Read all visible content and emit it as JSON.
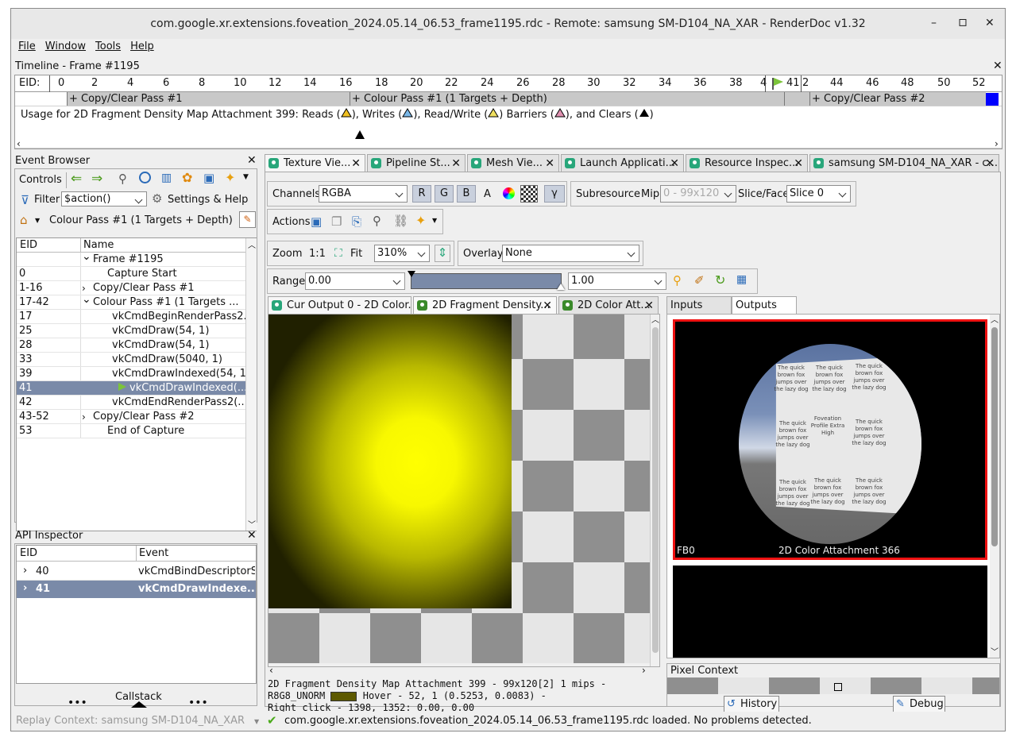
{
  "window": {
    "title": "com.google.xr.extensions.foveation_2024.05.14_06.53_frame1195.rdc - Remote: samsung SM-D104_NA_XAR - RenderDoc v1.32",
    "minimize": "–",
    "maximize": "▫",
    "close": "✕"
  },
  "menu": [
    "File",
    "Window",
    "Tools",
    "Help"
  ],
  "timeline": {
    "title": "Timeline - Frame #1195",
    "eid_label": "EID:",
    "ticks": [
      "0",
      "2",
      "4",
      "6",
      "8",
      "10",
      "12",
      "14",
      "16",
      "18",
      "20",
      "22",
      "24",
      "26",
      "28",
      "30",
      "32",
      "34",
      "36",
      "38",
      "4",
      "41",
      "2",
      "44",
      "46",
      "48",
      "50",
      "52"
    ],
    "passes": [
      "+ Copy/Clear Pass #1",
      "+ Colour Pass #1 (1 Targets + Depth)",
      "+ Copy/Clear Pass #2"
    ],
    "usage_prefix": "Usage for 2D Fragment Density Map Attachment 399:  Reads (",
    "usage_writes": "), Writes (",
    "usage_rw": "), Read/Write (",
    "usage_barriers": ") Barriers (",
    "usage_clears": "), and Clears (",
    "usage_suffix": ")"
  },
  "event_browser": {
    "title": "Event Browser",
    "controls_label": "Controls",
    "filter_label": "Filter",
    "filter_value": "$action()",
    "settings_label": "Settings & Help",
    "breadcrumb": "Colour Pass #1 (1 Targets + Depth)",
    "col_eid": "EID",
    "col_name": "Name",
    "rows": [
      {
        "eid": "",
        "name": "Frame #1195"
      },
      {
        "eid": "0",
        "name": "Capture Start"
      },
      {
        "eid": "1-16",
        "name": "Copy/Clear Pass #1"
      },
      {
        "eid": "17-42",
        "name": "Colour Pass #1 (1 Targets ..."
      },
      {
        "eid": "17",
        "name": "vkCmdBeginRenderPass2..."
      },
      {
        "eid": "25",
        "name": "vkCmdDraw(54, 1)"
      },
      {
        "eid": "28",
        "name": "vkCmdDraw(54, 1)"
      },
      {
        "eid": "33",
        "name": "vkCmdDraw(5040, 1)"
      },
      {
        "eid": "39",
        "name": "vkCmdDrawIndexed(54, 1)"
      },
      {
        "eid": "41",
        "name": "vkCmdDrawIndexed(..."
      },
      {
        "eid": "42",
        "name": "vkCmdEndRenderPass2(..."
      },
      {
        "eid": "43-52",
        "name": "Copy/Clear Pass #2"
      },
      {
        "eid": "53",
        "name": "End of Capture"
      }
    ]
  },
  "api_inspector": {
    "title": "API Inspector",
    "col_eid": "EID",
    "col_event": "Event",
    "rows": [
      {
        "eid": "40",
        "event": "vkCmdBindDescriptorSe"
      },
      {
        "eid": "41",
        "event": "vkCmdDrawIndexe..."
      }
    ],
    "callstack": "Callstack",
    "dots": "•••"
  },
  "main_tabs": [
    "Texture Vie...",
    "Pipeline St...",
    "Mesh Vie...",
    "Launch Applicati...",
    "Resource Inspec...",
    "samsung SM-D104_NA_XAR - c..."
  ],
  "texture_viewer": {
    "channels_label": "Channels",
    "channels_value": "RGBA",
    "r": "R",
    "g": "G",
    "b": "B",
    "a": "A",
    "gamma": "γ",
    "subresource_label": "Subresource",
    "mip_label": "Mip",
    "mip_value": "0 - 99x120",
    "slice_label": "Slice/Face",
    "slice_value": "Slice 0",
    "actions_label": "Actions",
    "zoom_label": "Zoom",
    "zoom_1to1": "1:1",
    "fit_label": "Fit",
    "zoom_value": "310%",
    "overlay_label": "Overlay",
    "overlay_value": "None",
    "range_label": "Range",
    "range_min": "0.00",
    "range_max": "1.00",
    "sub_tabs": [
      "Cur Output 0 - 2D Color...",
      "2D Fragment Density...",
      "2D Color Att..."
    ],
    "status_line1": "2D Fragment Density Map Attachment 399 - 99x120[2] 1 mips -",
    "status_format": "R8G8_UNORM",
    "status_hover": "Hover -    52,    1 (0.5253, 0.0083)  -",
    "status_line3": "Right click - 1398, 1352: 0.00, 0.00",
    "swatch_color": "#5d5900"
  },
  "side": {
    "tab_inputs": "Inputs",
    "tab_outputs": "Outputs",
    "thumb_left": "FB0",
    "thumb_right": "2D Color Attachment 366",
    "card_text": [
      "The quick brown fox jumps over the lazy dog",
      "The quick brown fox jumps over the lazy dog",
      "The quick brown fox jumps over the lazy dog",
      "The quick brown fox jumps over the lazy dog",
      "Foveation Profile Extra High",
      "The quick brown fox jumps over the lazy dog",
      "The quick brown fox jumps over the lazy dog",
      "The quick brown fox jumps over the lazy dog",
      "The quick brown fox jumps over the lazy dog"
    ],
    "pixel_context": "Pixel Context",
    "history": "History",
    "debug": "Debug"
  },
  "statusbar": {
    "replay": "Replay Context: samsung SM-D104_NA_XAR",
    "message": "com.google.xr.extensions.foveation_2024.05.14_06.53_frame1195.rdc loaded. No problems detected."
  },
  "colors": {
    "selection": "#7a8aa8",
    "accent": "#28a67a",
    "highlight": "#ff0000",
    "yellow": "#ffff00"
  }
}
